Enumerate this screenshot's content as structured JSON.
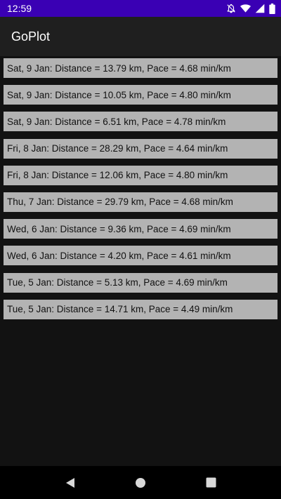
{
  "status_bar": {
    "time": "12:59",
    "icons": [
      "notifications-off-icon",
      "wifi-icon",
      "signal-icon",
      "battery-icon"
    ]
  },
  "app_bar": {
    "title": "GoPlot"
  },
  "runs": [
    "Sat, 9 Jan: Distance = 13.79 km, Pace = 4.68 min/km",
    "Sat, 9 Jan: Distance = 10.05 km, Pace = 4.80 min/km",
    "Sat, 9 Jan: Distance = 6.51 km, Pace = 4.78 min/km",
    "Fri, 8 Jan: Distance = 28.29 km, Pace = 4.64 min/km",
    "Fri, 8 Jan: Distance = 12.06 km, Pace = 4.80 min/km",
    "Thu, 7 Jan: Distance = 29.79 km, Pace = 4.68 min/km",
    "Wed, 6 Jan: Distance = 9.36 km, Pace = 4.69 min/km",
    "Wed, 6 Jan: Distance = 4.20 km, Pace = 4.61 min/km",
    "Tue, 5 Jan: Distance = 5.13 km, Pace = 4.69 min/km",
    "Tue, 5 Jan: Distance = 14.71 km, Pace = 4.49 min/km"
  ],
  "nav_bar": {
    "buttons": [
      "back-icon",
      "home-icon",
      "recents-icon"
    ]
  },
  "colors": {
    "status_bar": "#3a00b4",
    "app_bar": "#1f1f1f",
    "background": "#121212",
    "list_item": "#b3b3b3"
  }
}
